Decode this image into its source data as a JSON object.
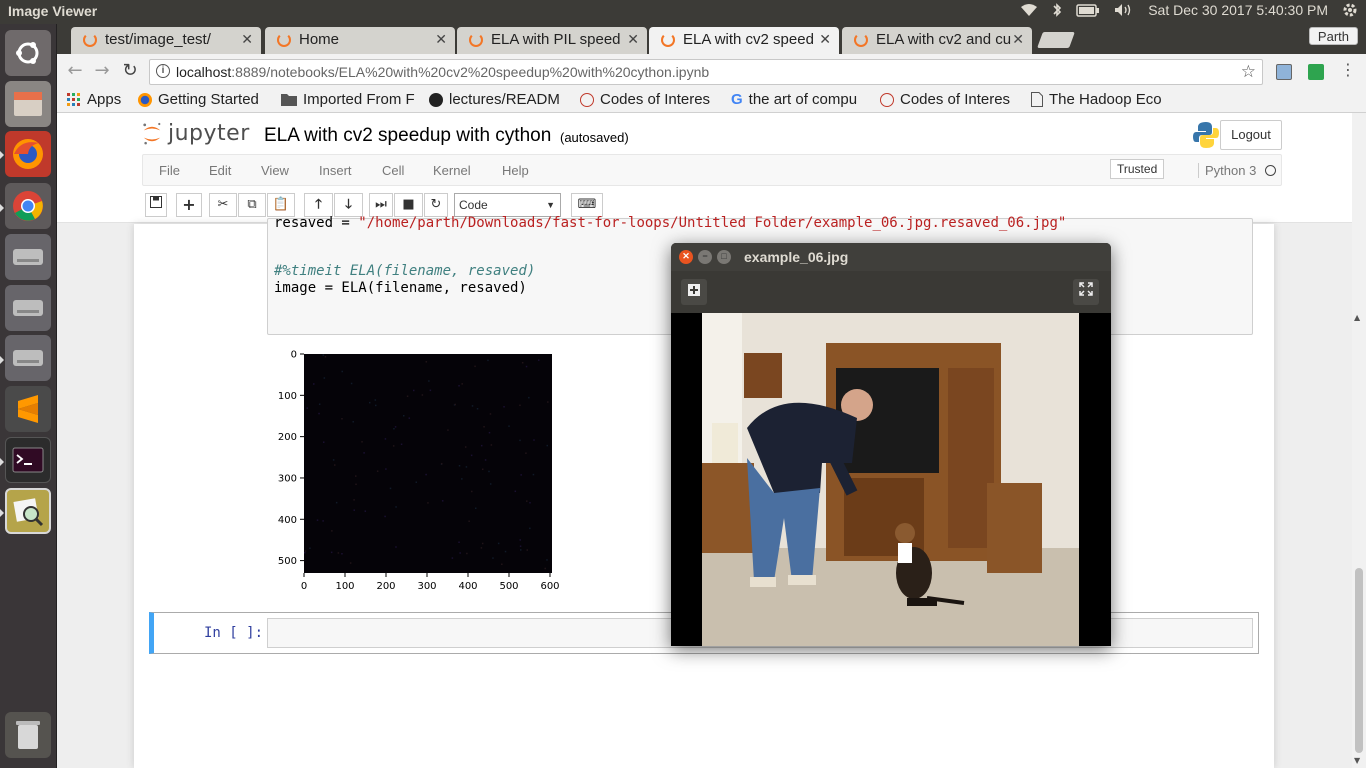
{
  "system": {
    "app_title": "Image Viewer",
    "datetime": "Sat Dec 30 2017  5:40:30 PM",
    "icons": [
      "wifi-icon",
      "bluetooth-icon",
      "battery-icon",
      "volume-icon",
      "gear-icon"
    ]
  },
  "launcher": {
    "items": [
      "ubuntu-dash-icon",
      "files-icon",
      "firefox-icon",
      "chrome-icon",
      "drive-icon",
      "drive-icon",
      "drive-icon",
      "sublime-text-icon",
      "terminal-icon",
      "image-viewer-icon",
      "trash-icon"
    ]
  },
  "browser": {
    "tabs": [
      {
        "label": "test/image_test/",
        "active": false
      },
      {
        "label": "Home",
        "active": false
      },
      {
        "label": "ELA with PIL speed",
        "active": false
      },
      {
        "label": "ELA with cv2 speed",
        "active": true
      },
      {
        "label": "ELA with cv2 and cu",
        "active": false
      }
    ],
    "profile": "Parth",
    "url_host": "localhost",
    "url_rest": ":8889/notebooks/ELA%20with%20cv2%20speedup%20with%20cython.ipynb",
    "bookmarks": [
      {
        "label": "Apps",
        "icon": "apps-grid-icon"
      },
      {
        "label": "Getting Started",
        "icon": "firefox-icon"
      },
      {
        "label": "Imported From F",
        "icon": "folder-icon"
      },
      {
        "label": "lectures/READM",
        "icon": "github-icon"
      },
      {
        "label": "Codes of Interes",
        "icon": "coi-icon"
      },
      {
        "label": "the art of compu",
        "icon": "google-icon"
      },
      {
        "label": "Codes of Interes",
        "icon": "coi-icon"
      },
      {
        "label": "The Hadoop Eco",
        "icon": "page-icon"
      }
    ]
  },
  "jupyter": {
    "logo_text": "jupyter",
    "notebook_title": "ELA with cv2 speedup with cython",
    "autosaved": "(autosaved)",
    "logout": "Logout",
    "menus": [
      "File",
      "Edit",
      "View",
      "Insert",
      "Cell",
      "Kernel",
      "Help"
    ],
    "trusted": "Trusted",
    "kernel": "Python 3",
    "cell_type": "Code",
    "code_lines": {
      "line1_prefix": "resaved = ",
      "line1_string": "\"/home/parth/Downloads/fast-for-loops/Untitled Folder/example_06.jpg.resaved_06.jpg\"",
      "line2_comment": "#%timeit ELA(filename, resaved)",
      "line3": "image = ELA(filename, resaved)"
    },
    "prompt": "In [ ]:"
  },
  "chart_data": {
    "type": "heatmap",
    "title": "",
    "x_ticks": [
      "0",
      "100",
      "200",
      "300",
      "400",
      "500",
      "600"
    ],
    "y_ticks": [
      "0",
      "100",
      "200",
      "300",
      "400",
      "500"
    ],
    "xlim": [
      0,
      600
    ],
    "ylim": [
      530,
      0
    ],
    "image": "near-black ELA output image"
  },
  "viewer": {
    "title": "example_06.jpg"
  }
}
